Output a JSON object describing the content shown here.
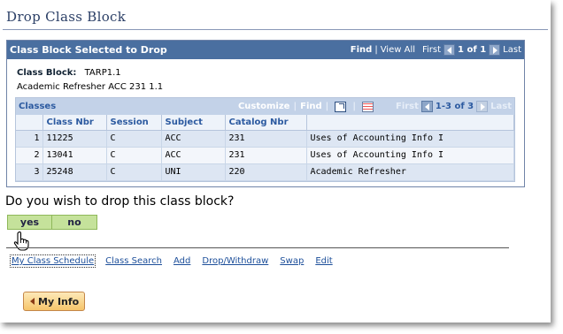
{
  "page": {
    "title": "Drop Class Block"
  },
  "panel": {
    "title": "Class Block Selected to Drop",
    "find": "Find",
    "view_all": "View All",
    "first": "First",
    "range": "1 of 1",
    "last": "Last"
  },
  "block": {
    "label": "Class Block:",
    "code": "TARP1.1",
    "description": "Academic Refresher ACC 231 1.1"
  },
  "classes": {
    "title": "Classes",
    "customize": "Customize",
    "find": "Find",
    "first": "First",
    "range": "1-3 of 3",
    "last": "Last",
    "columns": [
      "Class Nbr",
      "Session",
      "Subject",
      "Catalog Nbr",
      ""
    ],
    "rows": [
      {
        "num": "1",
        "class_nbr": "11225",
        "session": "C",
        "subject": "ACC",
        "catalog": "231",
        "title": "Uses of Accounting Info I"
      },
      {
        "num": "2",
        "class_nbr": "13041",
        "session": "C",
        "subject": "ACC",
        "catalog": "231",
        "title": "Uses of Accounting Info I"
      },
      {
        "num": "3",
        "class_nbr": "25248",
        "session": "C",
        "subject": "UNI",
        "catalog": "220",
        "title": "Academic Refresher"
      }
    ]
  },
  "prompt": {
    "question": "Do you wish to drop this class block?",
    "yes": "yes",
    "no": "no"
  },
  "links": [
    "My Class Schedule",
    "Class Search",
    "Add",
    "Drop/Withdraw",
    "Swap",
    "Edit"
  ],
  "myinfo": {
    "label": "My Info"
  },
  "colors": {
    "header_bg": "#4a6fa0",
    "subheader_bg": "#c3d2e8",
    "button_green": "#c5e29b",
    "link": "#1d4f9a",
    "myinfo_bg": "#f6c56b"
  }
}
